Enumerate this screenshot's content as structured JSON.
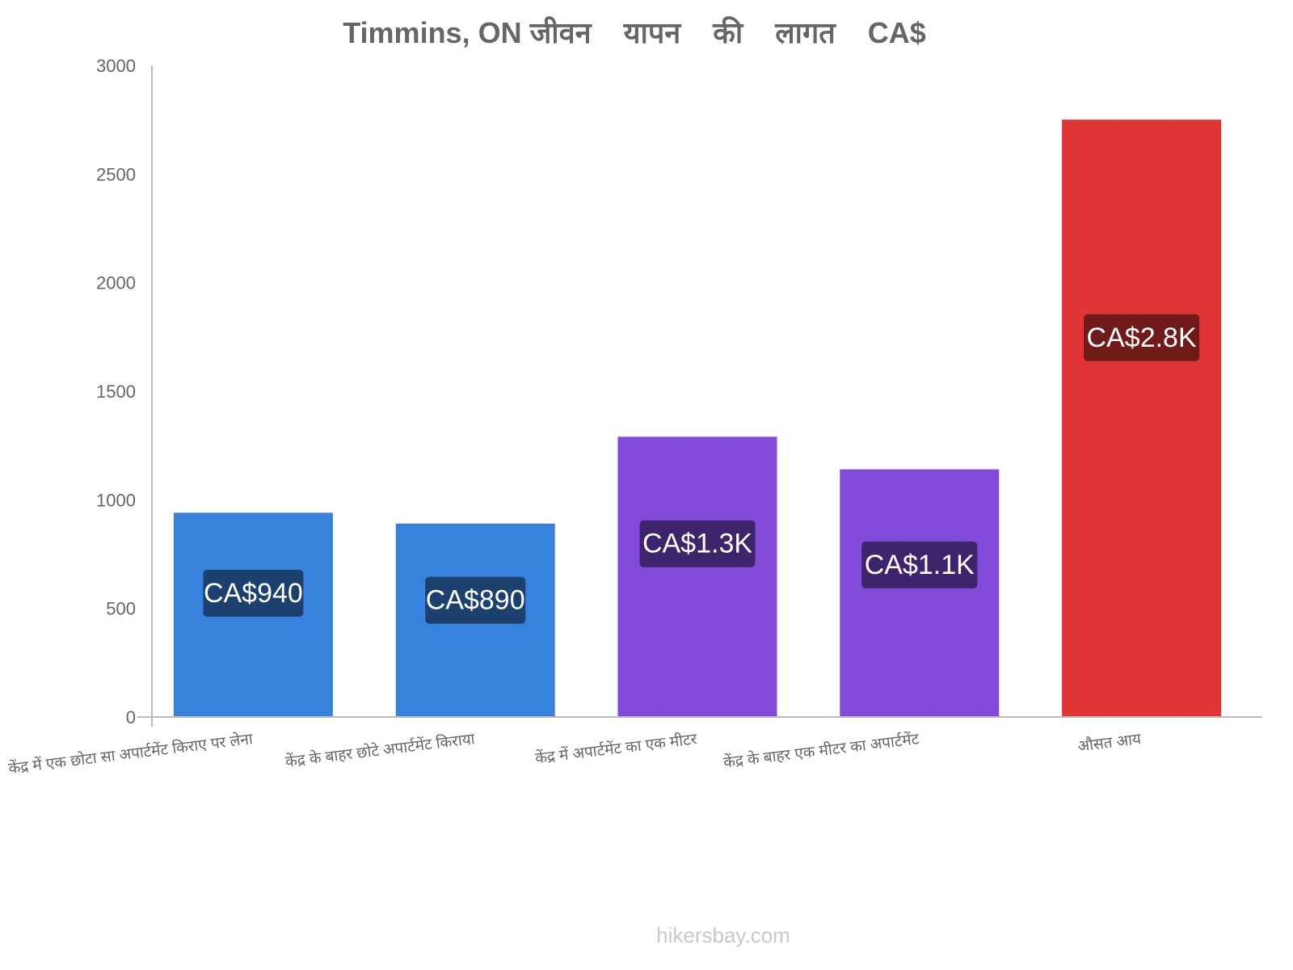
{
  "chart_data": {
    "type": "bar",
    "title": "Timmins, ON जीवन    यापन    की    लागत    CA$",
    "xlabel": "",
    "ylabel": "",
    "ylim": [
      0,
      3000
    ],
    "yticks": [
      0,
      500,
      1000,
      1500,
      2000,
      2500,
      3000
    ],
    "grid": false,
    "legend": "none",
    "categories": [
      "केंद्र में एक छोटा सा अपार्टमेंट किराए पर लेना",
      "केंद्र के बाहर छोटे अपार्टमेंट किराया",
      "केंद्र में अपार्टमेंट का एक मीटर",
      "केंद्र के बाहर एक मीटर का अपार्टमेंट",
      "औसत आय"
    ],
    "values": [
      940,
      890,
      1290,
      1140,
      2750
    ],
    "data_labels": [
      "CA$940",
      "CA$890",
      "CA$1.3K",
      "CA$1.1K",
      "CA$2.8K"
    ],
    "bar_colors": [
      "#3682dd",
      "#3682dd",
      "#824ad8",
      "#824ad8",
      "#e03535"
    ],
    "label_colors": [
      "#1c416e",
      "#1c416e",
      "#3e246b",
      "#3e246b",
      "#701a1a"
    ]
  },
  "footer": {
    "watermark": "hikersbay.com"
  }
}
